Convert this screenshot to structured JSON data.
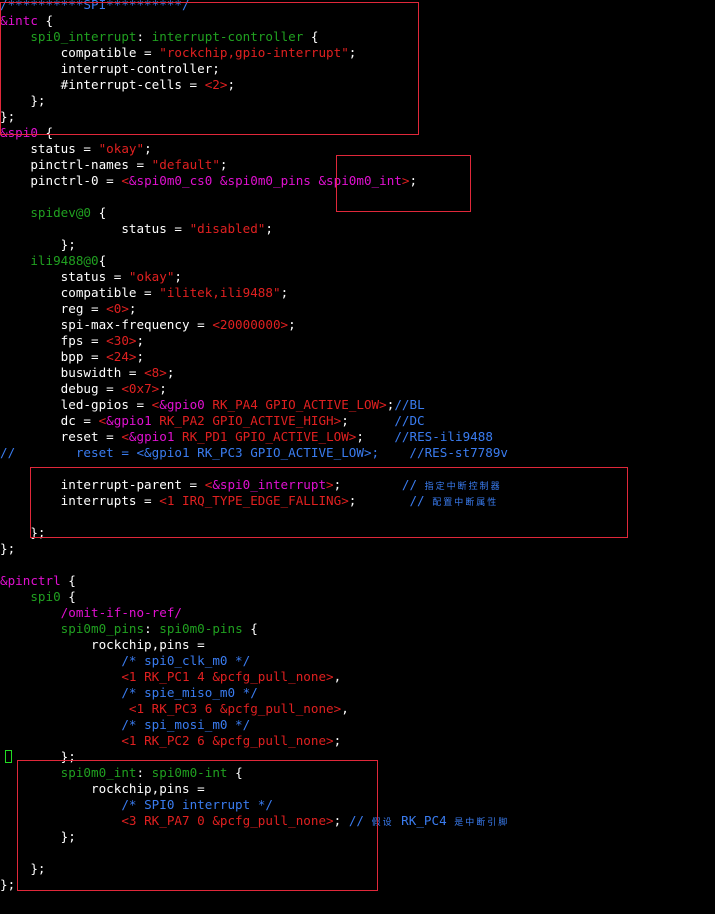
{
  "lines": [
    [
      [
        "b",
        "/**********SPI**********/"
      ]
    ],
    [
      [
        "m",
        "&intc"
      ],
      [
        "w",
        " {"
      ]
    ],
    [
      [
        "w",
        "    "
      ],
      [
        "g",
        "spi0_interrupt"
      ],
      [
        "w",
        ": "
      ],
      [
        "g",
        "interrupt-controller"
      ],
      [
        "w",
        " {"
      ]
    ],
    [
      [
        "w",
        "        compatible = "
      ],
      [
        "r",
        "\"rockchip,gpio-interrupt\""
      ],
      [
        "w",
        ";"
      ]
    ],
    [
      [
        "w",
        "        interrupt-controller;"
      ]
    ],
    [
      [
        "w",
        "        #interrupt-cells = "
      ],
      [
        "r",
        "<2>"
      ],
      [
        "w",
        ";"
      ]
    ],
    [
      [
        "w",
        "    };"
      ]
    ],
    [
      [
        "w",
        "};"
      ]
    ],
    [
      [
        "m",
        "&spi0"
      ],
      [
        "w",
        " {"
      ]
    ],
    [
      [
        "w",
        "    status = "
      ],
      [
        "r",
        "\"okay\""
      ],
      [
        "w",
        ";"
      ]
    ],
    [
      [
        "w",
        "    pinctrl-names = "
      ],
      [
        "r",
        "\"default\""
      ],
      [
        "w",
        ";"
      ]
    ],
    [
      [
        "w",
        "    pinctrl-0 = "
      ],
      [
        "r",
        "<"
      ],
      [
        "m",
        "&spi0m0_cs0 &spi0m0_pins &spi0m0_int"
      ],
      [
        "r",
        ">"
      ],
      [
        "w",
        ";"
      ]
    ],
    [
      [
        "w",
        ""
      ]
    ],
    [
      [
        "w",
        "    "
      ],
      [
        "g",
        "spidev@0"
      ],
      [
        "w",
        " {"
      ]
    ],
    [
      [
        "w",
        "                status = "
      ],
      [
        "r",
        "\"disabled\""
      ],
      [
        "w",
        ";"
      ]
    ],
    [
      [
        "w",
        "        };"
      ]
    ],
    [
      [
        "w",
        "    "
      ],
      [
        "g",
        "ili9488@0"
      ],
      [
        "w",
        "{"
      ]
    ],
    [
      [
        "w",
        "        status = "
      ],
      [
        "r",
        "\"okay\""
      ],
      [
        "w",
        ";"
      ]
    ],
    [
      [
        "w",
        "        compatible = "
      ],
      [
        "r",
        "\"ilitek,ili9488\""
      ],
      [
        "w",
        ";"
      ]
    ],
    [
      [
        "w",
        "        reg = "
      ],
      [
        "r",
        "<0>"
      ],
      [
        "w",
        ";"
      ]
    ],
    [
      [
        "w",
        "        spi-max-frequency = "
      ],
      [
        "r",
        "<20000000>"
      ],
      [
        "w",
        ";"
      ]
    ],
    [
      [
        "w",
        "        fps = "
      ],
      [
        "r",
        "<30>"
      ],
      [
        "w",
        ";"
      ]
    ],
    [
      [
        "w",
        "        bpp = "
      ],
      [
        "r",
        "<24>"
      ],
      [
        "w",
        ";"
      ]
    ],
    [
      [
        "w",
        "        buswidth = "
      ],
      [
        "r",
        "<8>"
      ],
      [
        "w",
        ";"
      ]
    ],
    [
      [
        "w",
        "        debug = "
      ],
      [
        "r",
        "<0x7>"
      ],
      [
        "w",
        ";"
      ]
    ],
    [
      [
        "w",
        "        led-gpios = "
      ],
      [
        "r",
        "<"
      ],
      [
        "m",
        "&gpio0"
      ],
      [
        "r",
        " RK_PA4 GPIO_ACTIVE_LOW>"
      ],
      [
        "w",
        ";"
      ],
      [
        "b",
        "//BL"
      ]
    ],
    [
      [
        "w",
        "        dc = "
      ],
      [
        "r",
        "<"
      ],
      [
        "m",
        "&gpio1"
      ],
      [
        "r",
        " RK_PA2 GPIO_ACTIVE_HIGH>"
      ],
      [
        "w",
        ";      "
      ],
      [
        "b",
        "//DC"
      ]
    ],
    [
      [
        "w",
        "        reset = "
      ],
      [
        "r",
        "<"
      ],
      [
        "m",
        "&gpio1"
      ],
      [
        "r",
        " RK_PD1 GPIO_ACTIVE_LOW>"
      ],
      [
        "w",
        ";    "
      ],
      [
        "b",
        "//RES-ili9488"
      ]
    ],
    [
      [
        "b",
        "//        reset = <&gpio1 RK_PC3 GPIO_ACTIVE_LOW>;    //RES-st7789v"
      ]
    ],
    [
      [
        "w",
        ""
      ]
    ],
    [
      [
        "w",
        "        interrupt-parent = "
      ],
      [
        "r",
        "<"
      ],
      [
        "m",
        "&spi0_interrupt"
      ],
      [
        "r",
        ">"
      ],
      [
        "w",
        ";        "
      ],
      [
        "b",
        "// "
      ],
      [
        "cj",
        "指定中断控制器"
      ]
    ],
    [
      [
        "w",
        "        interrupts = "
      ],
      [
        "r",
        "<1 IRQ_TYPE_EDGE_FALLING>"
      ],
      [
        "w",
        ";       "
      ],
      [
        "b",
        "// "
      ],
      [
        "cj",
        "配置中断属性"
      ]
    ],
    [
      [
        "w",
        ""
      ]
    ],
    [
      [
        "w",
        "    };"
      ]
    ],
    [
      [
        "w",
        "};"
      ]
    ],
    [
      [
        "w",
        ""
      ]
    ],
    [
      [
        "m",
        "&pinctrl"
      ],
      [
        "w",
        " {"
      ]
    ],
    [
      [
        "w",
        "    "
      ],
      [
        "g",
        "spi0"
      ],
      [
        "w",
        " {"
      ]
    ],
    [
      [
        "w",
        "        "
      ],
      [
        "m",
        "/omit-if-no-ref/"
      ]
    ],
    [
      [
        "w",
        "        "
      ],
      [
        "g",
        "spi0m0_pins"
      ],
      [
        "w",
        ": "
      ],
      [
        "g",
        "spi0m0-pins"
      ],
      [
        "w",
        " {"
      ]
    ],
    [
      [
        "w",
        "            rockchip,pins ="
      ]
    ],
    [
      [
        "w",
        "                "
      ],
      [
        "b",
        "/* spi0_clk_m0 */"
      ]
    ],
    [
      [
        "w",
        "                "
      ],
      [
        "r",
        "<1 RK_PC1 4 &pcfg_pull_none>"
      ],
      [
        "w",
        ","
      ]
    ],
    [
      [
        "w",
        "                "
      ],
      [
        "b",
        "/* spie_miso_m0 */"
      ]
    ],
    [
      [
        "w",
        "                 "
      ],
      [
        "r",
        "<1 RK_PC3 6 &pcfg_pull_none>"
      ],
      [
        "w",
        ","
      ]
    ],
    [
      [
        "w",
        "                "
      ],
      [
        "b",
        "/* spi_mosi_m0 */"
      ]
    ],
    [
      [
        "w",
        "                "
      ],
      [
        "r",
        "<1 RK_PC2 6 &pcfg_pull_none>"
      ],
      [
        "w",
        ";"
      ]
    ],
    [
      [
        "w",
        "        };"
      ]
    ],
    [
      [
        "w",
        "        "
      ],
      [
        "g",
        "spi0m0_int"
      ],
      [
        "w",
        ": "
      ],
      [
        "g",
        "spi0m0-int"
      ],
      [
        "w",
        " {"
      ]
    ],
    [
      [
        "w",
        "            rockchip,pins ="
      ]
    ],
    [
      [
        "w",
        "                "
      ],
      [
        "b",
        "/* SPI0 interrupt */"
      ]
    ],
    [
      [
        "w",
        "                "
      ],
      [
        "r",
        "<3 RK_PA7 0 &pcfg_pull_none>"
      ],
      [
        "w",
        "; "
      ],
      [
        "b",
        "// "
      ],
      [
        "cj",
        "假设"
      ],
      [
        "b",
        " RK_PC4 "
      ],
      [
        "cj",
        "是中断引脚"
      ]
    ],
    [
      [
        "w",
        "        };"
      ]
    ],
    [
      [
        "w",
        ""
      ]
    ],
    [
      [
        "w",
        "    };"
      ]
    ],
    [
      [
        "w",
        "};"
      ]
    ]
  ],
  "highlight_color": "#e0283a",
  "cursor_color": "#22dd22"
}
